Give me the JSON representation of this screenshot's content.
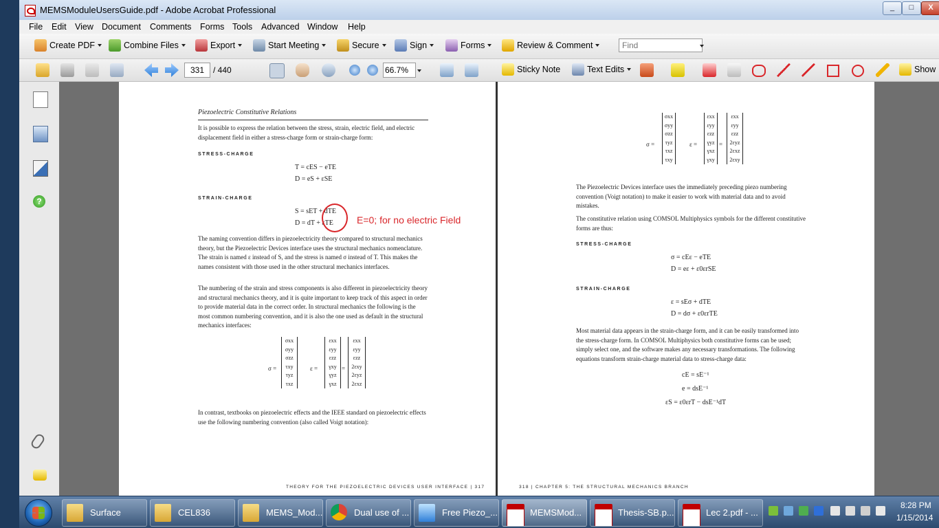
{
  "window": {
    "title": "MEMSModuleUsersGuide.pdf - Adobe Acrobat Professional",
    "min": "_",
    "max": "□",
    "close": "X"
  },
  "menu": [
    "File",
    "Edit",
    "View",
    "Document",
    "Comments",
    "Forms",
    "Tools",
    "Advanced",
    "Window",
    "Help"
  ],
  "toolbar1": {
    "create_pdf": "Create PDF",
    "combine_files": "Combine Files",
    "export": "Export",
    "start_meeting": "Start Meeting",
    "secure": "Secure",
    "sign": "Sign",
    "forms": "Forms",
    "review_comment": "Review & Comment",
    "find_placeholder": "Find"
  },
  "toolbar2": {
    "page_current": "331",
    "page_total": "/ 440",
    "zoom": "66.7%",
    "sticky_note": "Sticky Note",
    "text_edits": "Text Edits",
    "show": "Show"
  },
  "page_left": {
    "section_title": "Piezoelectric Constitutive Relations",
    "intro": "It is possible to express the relation between the stress, strain, electric field, and electric displacement field in either a stress-charge form or strain-charge form:",
    "heading_stress": "STRESS-CHARGE",
    "eq1": "T = cES − eTE",
    "eq2": "D = eS + εSE",
    "heading_strain": "STRAIN-CHARGE",
    "eq3": "S = sET + dTE",
    "eq4": "D = dT + εTE",
    "para1": "The naming convention differs in piezoelectricity theory compared to structural mechanics theory, but the Piezoelectric Devices interface uses the structural mechanics nomenclature. The strain is named ε instead of S, and the stress is named σ instead of T. This makes the names consistent with those used in the other structural mechanics interfaces.",
    "para2": "The numbering of the strain and stress components is also different in piezoelectricity theory and structural mechanics theory, and it is quite important to keep track of this aspect in order to provide material data in the correct order. In structural mechanics the following is the most common numbering convention, and it is also the one used as default in the structural mechanics interfaces:",
    "sigma_label": "σ =",
    "eps_label": "ε =",
    "eq_sign": "=",
    "m1": [
      "σxx",
      "σyy",
      "σzz",
      "τxy",
      "τyz",
      "τxz"
    ],
    "m2": [
      "εxx",
      "εyy",
      "εzz",
      "γxy",
      "γyz",
      "γxz"
    ],
    "m3": [
      "εxx",
      "εyy",
      "εzz",
      "2εxy",
      "2εyz",
      "2εxz"
    ],
    "para3": "In contrast, textbooks on piezoelectric effects and the IEEE standard on piezoelectric effects use the following numbering convention (also called Voigt notation):",
    "footer": "THEORY FOR THE PIEZOELECTRIC DEVICES USER INTERFACE  |  317",
    "annotation": "E=0; for no electric Field"
  },
  "page_right": {
    "sigma_label": "σ =",
    "eps_label": "ε =",
    "eq_sign": "=",
    "m1": [
      "σxx",
      "σyy",
      "σzz",
      "τyz",
      "τxz",
      "τxy"
    ],
    "m2": [
      "εxx",
      "εyy",
      "εzz",
      "γyz",
      "γxz",
      "γxy"
    ],
    "m3": [
      "εxx",
      "εyy",
      "εzz",
      "2εyz",
      "2εxz",
      "2εxy"
    ],
    "para1": "The Piezoelectric Devices interface uses the immediately preceding piezo numbering convention (Voigt notation) to make it easier to work with material data and to avoid mistakes.",
    "para2": "The constitutive relation using COMSOL Multiphysics symbols for the different constitutive forms are thus:",
    "heading_stress": "STRESS-CHARGE",
    "eq1": "σ = cEε − eTE",
    "eq2": "D = eε + ε0εrSE",
    "heading_strain": "STRAIN-CHARGE",
    "eq3": "ε = sEσ + dTE",
    "eq4": "D = dσ + ε0εrTE",
    "para3": "Most material data appears in the strain-charge form, and it can be easily transformed into the stress-charge form. In COMSOL Multiphysics both constitutive forms can be used; simply select one, and the software makes any necessary transformations. The following equations transform strain-charge material data to stress-charge data:",
    "eq5": "cE = sE⁻¹",
    "eq6": "e = dsE⁻¹",
    "eq7": "εS = ε0εrT − dsE⁻¹dT",
    "footer": "318  |  CHAPTER 5: THE STRUCTURAL MECHANICS BRANCH"
  },
  "taskbar": {
    "items": [
      "Surface",
      "CEL836",
      "MEMS_Mod...",
      "Dual use of ...",
      "Free Piezo_...",
      "MEMSMod...",
      "Thesis-SB.p...",
      "Lec 2.pdf - ..."
    ],
    "time": "8:28 PM",
    "date": "1/15/2014"
  },
  "colors": {
    "accent_red": "#d9262a",
    "pdf_red": "#c00000",
    "folder": "#e8c35a",
    "chrome": "#3f8ed8"
  }
}
